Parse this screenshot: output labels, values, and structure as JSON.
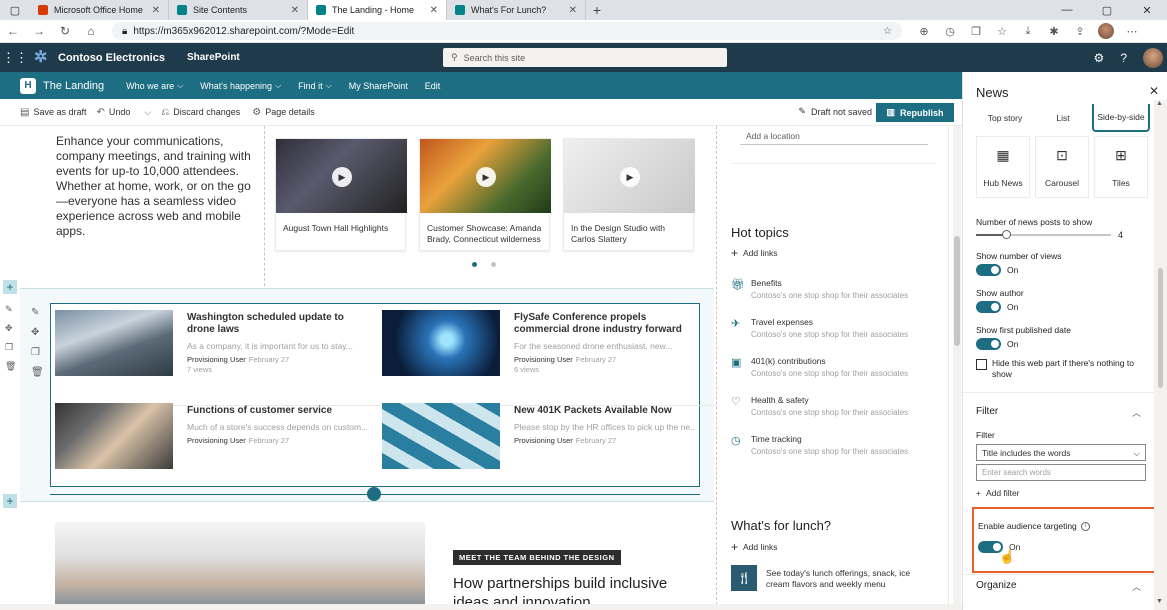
{
  "browser": {
    "tabs": [
      {
        "label": "Microsoft Office Home",
        "favicon": "office-icon"
      },
      {
        "label": "Site Contents",
        "favicon": "sharepoint-icon"
      },
      {
        "label": "The Landing - Home",
        "favicon": "sharepoint-icon",
        "active": true
      },
      {
        "label": "What's For Lunch?",
        "favicon": "sharepoint-icon"
      }
    ],
    "url": "https://m365x962012.sharepoint.com/?Mode=Edit"
  },
  "suite": {
    "brand": "Contoso Electronics",
    "app": "SharePoint",
    "search_placeholder": "Search this site"
  },
  "site": {
    "title": "The Landing",
    "logo_letter": "H",
    "nav": [
      "Who we are",
      "What's happening",
      "Find it",
      "My SharePoint",
      "Edit"
    ]
  },
  "commands": {
    "save_draft": "Save as draft",
    "undo": "Undo",
    "discard": "Discard changes",
    "page_details": "Page details",
    "draft_status": "Draft not saved",
    "republish": "Republish"
  },
  "intro_text": "Enhance your communications, company meetings, and training with events for up-to 10,000 attendees. Whether at home, work, or on the go—everyone has a seamless video experience across web and mobile apps.",
  "videos": [
    {
      "title": "August Town Hall Highlights"
    },
    {
      "title": "Customer Showcase: Amanda Brady, Connecticut wilderness"
    },
    {
      "title": "In the Design Studio with Carlos Slattery"
    }
  ],
  "news": [
    {
      "title": "Washington scheduled update to drone laws",
      "snippet": "As a company, it is important for us to stay...",
      "author": "Provisioning User",
      "date": "February 27",
      "views": "7 views"
    },
    {
      "title": "FlySafe Conference propels commercial drone industry forward",
      "snippet": "For the seasoned drone enthusiast, new...",
      "author": "Provisioning User",
      "date": "February 27",
      "views": "6 views"
    },
    {
      "title": "Functions of customer service",
      "snippet": "Much of a store's success depends on custom...",
      "author": "Provisioning User",
      "date": "February 27"
    },
    {
      "title": "New 401K Packets Available Now",
      "snippet": "Please stop by the HR offices to pick up the ne...",
      "author": "Provisioning User",
      "date": "February 27"
    }
  ],
  "team": {
    "tag": "MEET THE TEAM BEHIND THE DESIGN",
    "title": "How partnerships build inclusive ideas and innovation"
  },
  "location_placeholder": "Add a location",
  "hot_topics": {
    "title": "Hot topics",
    "add_links": "Add links",
    "items": [
      {
        "label": "Benefits",
        "desc": "Contoso's one stop shop for their associates",
        "icon": "gift-icon"
      },
      {
        "label": "Travel expenses",
        "desc": "Contoso's one stop shop for their associates",
        "icon": "plane-icon"
      },
      {
        "label": "401(k) contributions",
        "desc": "Contoso's one stop shop for their associates",
        "icon": "money-icon"
      },
      {
        "label": "Health & safety",
        "desc": "Contoso's one stop shop for their associates",
        "icon": "heart-icon"
      },
      {
        "label": "Time tracking",
        "desc": "Contoso's one stop shop for their associates",
        "icon": "clock-icon"
      }
    ]
  },
  "lunch": {
    "title": "What's for lunch?",
    "add_links": "Add links",
    "desc": "See today's lunch offerings, snack, ice cream flavors and weekly menu"
  },
  "pane": {
    "title": "News",
    "layouts": [
      "Top story",
      "List",
      "Side-by-side"
    ],
    "tiles": [
      "Hub News",
      "Carousel",
      "Tiles"
    ],
    "num_posts_label": "Number of news posts to show",
    "num_posts_value": "4",
    "show_views": "Show number of views",
    "show_author": "Show author",
    "show_published": "Show first published date",
    "on": "On",
    "hide_label": "Hide this web part if there's nothing to show",
    "filter_section": "Filter",
    "filter_label": "Filter",
    "filter_value": "Title includes the words",
    "filter_placeholder": "Enter search words",
    "add_filter": "Add filter",
    "audience_label": "Enable audience targeting",
    "organize": "Organize"
  }
}
